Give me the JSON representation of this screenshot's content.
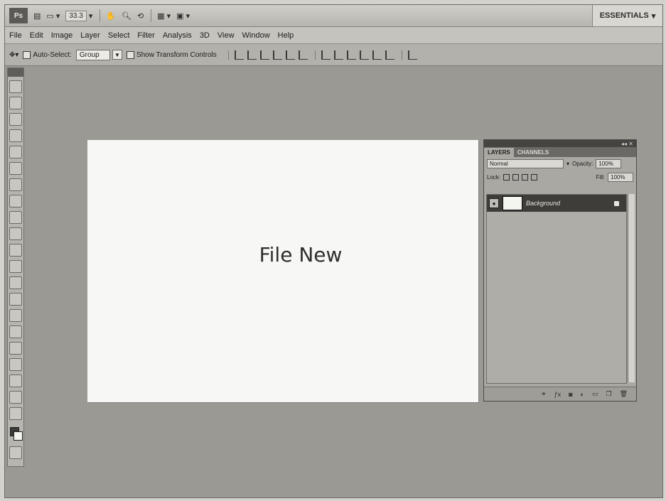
{
  "appbar": {
    "logo_label": "Ps",
    "zoom_value": "33.3",
    "workspace_label": "ESSENTIALS"
  },
  "menu": [
    "File",
    "Edit",
    "Image",
    "Layer",
    "Select",
    "Filter",
    "Analysis",
    "3D",
    "View",
    "Window",
    "Help"
  ],
  "options": {
    "auto_select_label": "Auto-Select:",
    "auto_select_value": "Group",
    "show_transform_label": "Show Transform Controls"
  },
  "document": {
    "title": "File New"
  },
  "layers_panel": {
    "tabs": [
      "LAYERS",
      "CHANNELS"
    ],
    "blend_mode": "Normal",
    "opacity_label": "Opacity:",
    "opacity_value": "100%",
    "lock_label": "Lock:",
    "fill_label": "Fill:",
    "fill_value": "100%",
    "layers": [
      {
        "name": "Background"
      }
    ],
    "footer_icons": [
      "link-icon",
      "fx-icon",
      "mask-icon",
      "adjustment-icon",
      "group-icon",
      "new-layer-icon",
      "trash-icon"
    ]
  },
  "colors": {
    "app_bg": "#9a9993",
    "document_bg": "#f7f7f5",
    "selected_layer_bg": "#3e3d3a"
  }
}
